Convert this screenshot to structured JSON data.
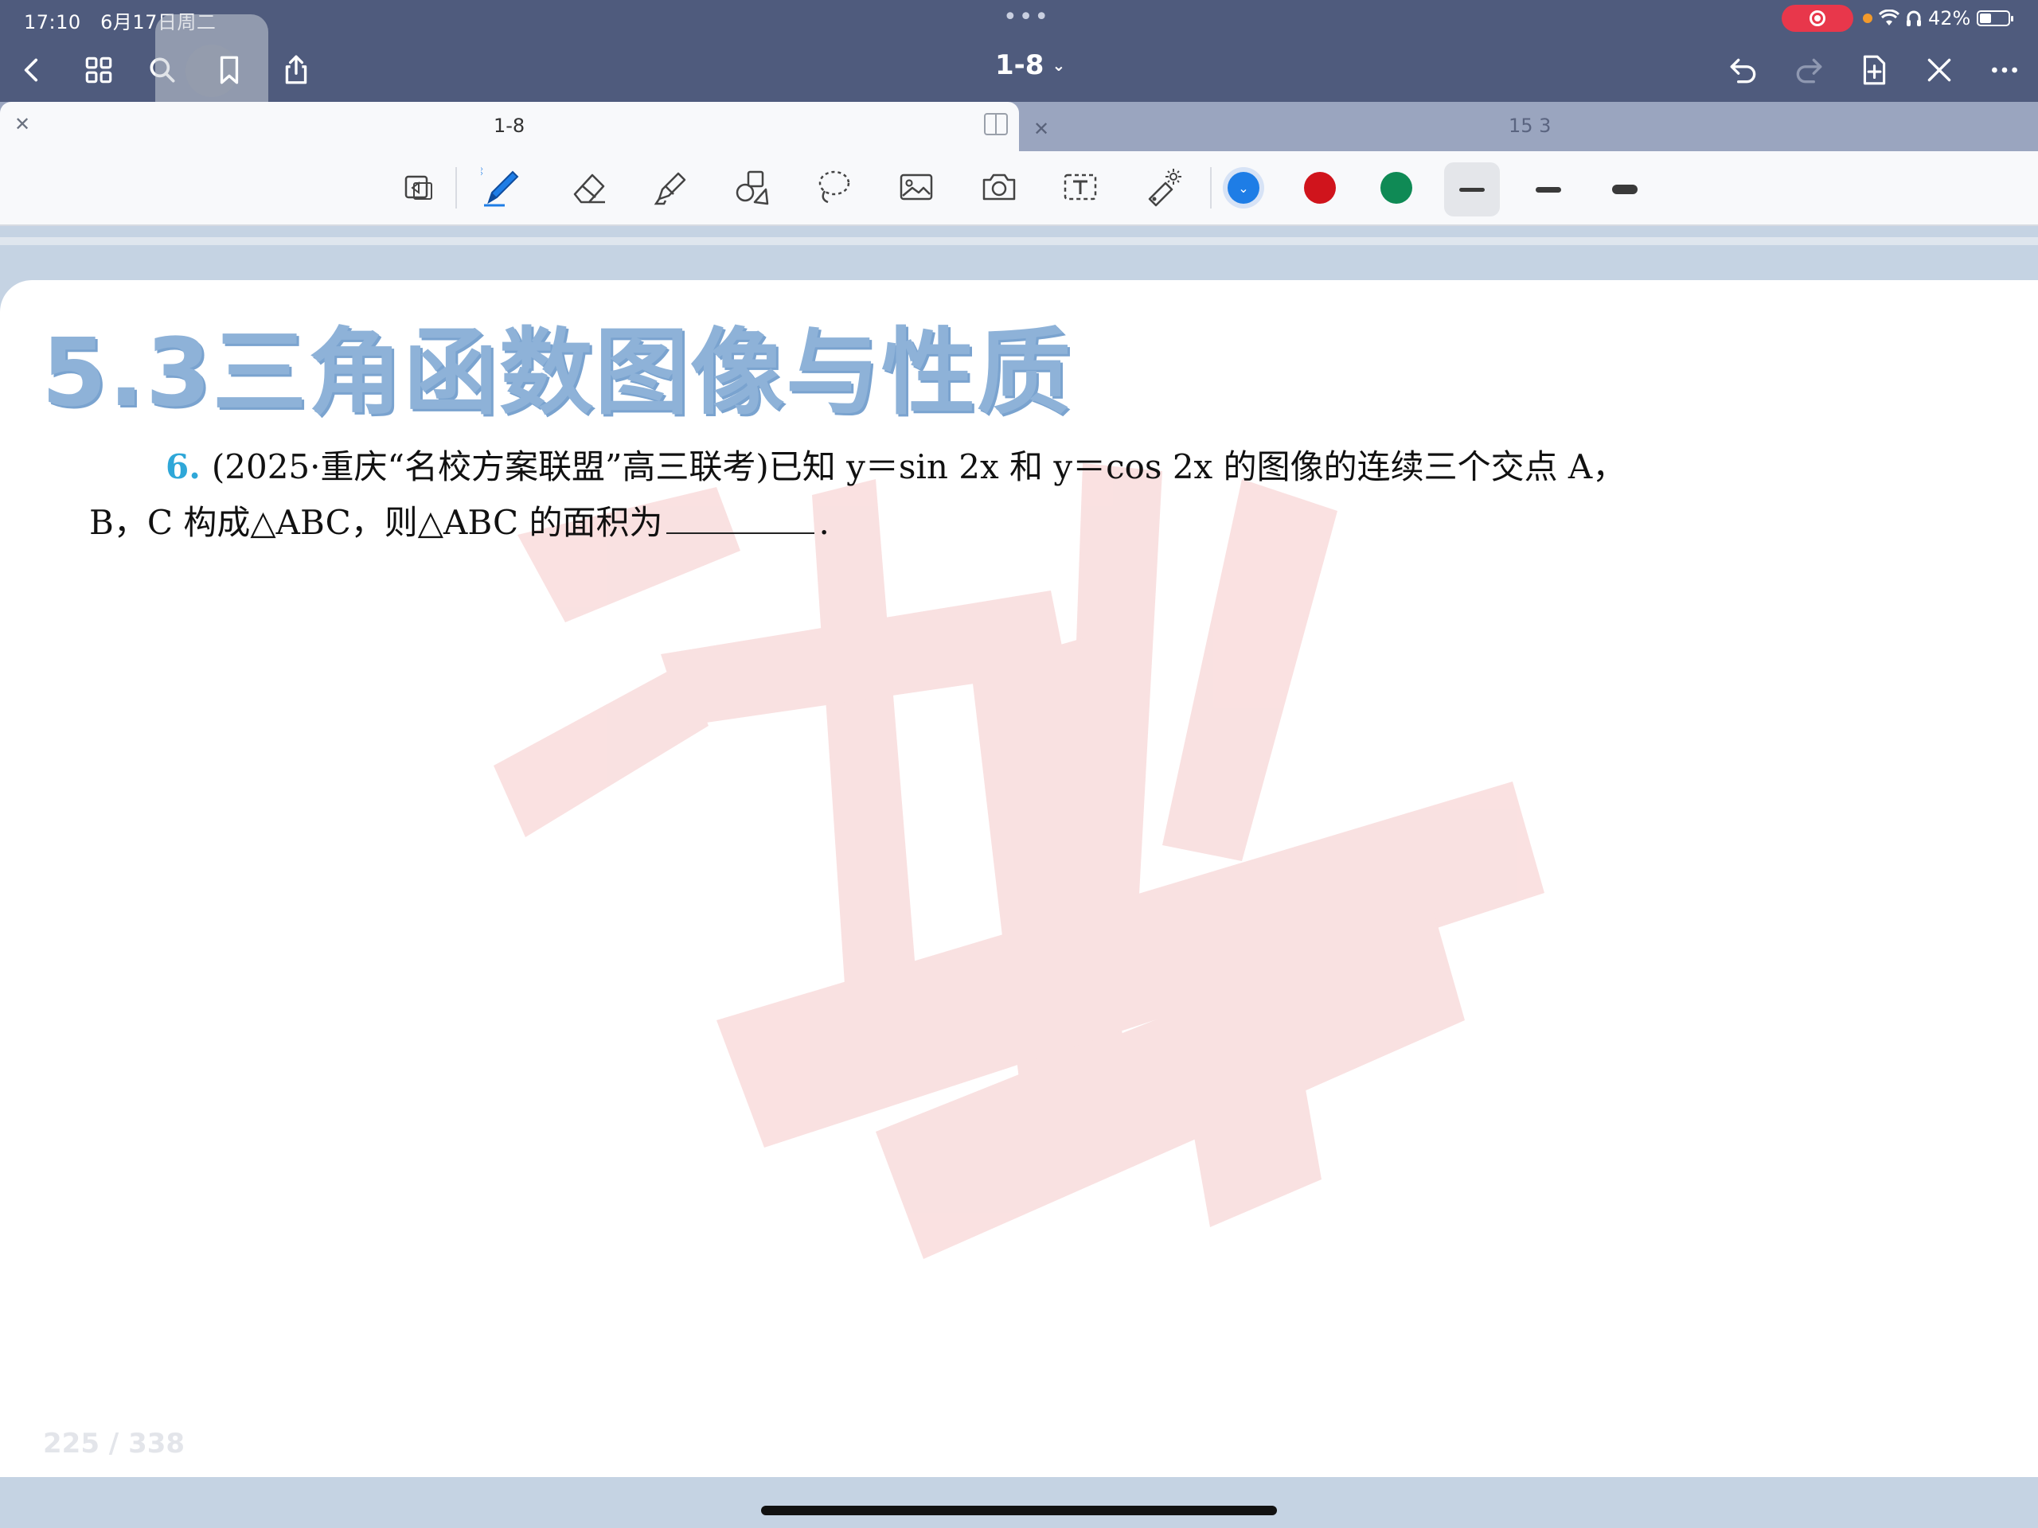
{
  "status_bar": {
    "time": "17:10",
    "date": "6月17日周二",
    "dots": "•••",
    "battery": "42%"
  },
  "title_bar": {
    "document_title": "1-8"
  },
  "tabs": [
    {
      "label": "1-8",
      "active": true
    },
    {
      "label": "15 3",
      "active": false
    }
  ],
  "toolbar": {
    "colors": [
      "#1e7de6",
      "#d0141c",
      "#0f8a55"
    ],
    "selected_color": "#1e7de6"
  },
  "page": {
    "section_title": "5.3三角函数图像与性质",
    "question": {
      "number": "6.",
      "line1": "(2025·重庆“名校方案联盟”高三联考)已知 y＝sin 2x 和 y＝cos 2x 的图像的连续三个交点 A，",
      "line2": "B，C 构成△ABC，则△ABC 的面积为",
      "line2_end": "."
    },
    "page_counter": "225 / 338"
  }
}
